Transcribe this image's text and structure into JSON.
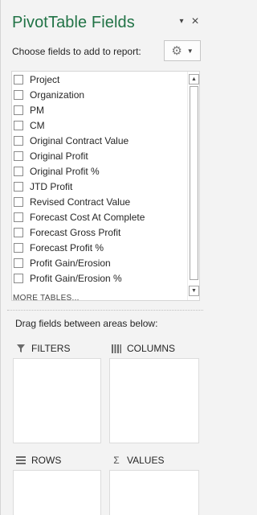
{
  "header": {
    "title": "PivotTable Fields",
    "dropdown_glyph": "▾",
    "close_glyph": "×"
  },
  "chooser": {
    "label": "Choose fields to add to report:",
    "settings_icon": "gear-icon",
    "settings_glyph": "⚙",
    "settings_caret": "▼"
  },
  "fields": [
    {
      "label": "Project",
      "checked": false
    },
    {
      "label": "Organization",
      "checked": false
    },
    {
      "label": "PM",
      "checked": false
    },
    {
      "label": "CM",
      "checked": false
    },
    {
      "label": "Original Contract Value",
      "checked": false
    },
    {
      "label": "Original Profit",
      "checked": false
    },
    {
      "label": "Original Profit %",
      "checked": false
    },
    {
      "label": "JTD Profit",
      "checked": false
    },
    {
      "label": "Revised Contract Value",
      "checked": false
    },
    {
      "label": "Forecast Cost At Complete",
      "checked": false
    },
    {
      "label": "Forecast Gross Profit",
      "checked": false
    },
    {
      "label": "Forecast Profit %",
      "checked": false
    },
    {
      "label": "Profit Gain/Erosion",
      "checked": false
    },
    {
      "label": "Profit Gain/Erosion %",
      "checked": false
    }
  ],
  "more_tables": "MORE TABLES...",
  "scrollbar": {
    "up_glyph": "▲",
    "down_glyph": "▼"
  },
  "drag_hint": "Drag fields between areas below:",
  "areas": {
    "filters": {
      "label": "FILTERS",
      "icon": "filter-icon"
    },
    "columns": {
      "label": "COLUMNS",
      "icon": "columns-icon"
    },
    "rows": {
      "label": "ROWS",
      "icon": "rows-icon"
    },
    "values": {
      "label": "VALUES",
      "icon": "sigma-icon",
      "glyph": "Σ"
    }
  },
  "colors": {
    "title": "#217346",
    "pane_background": "#f3f3f3"
  }
}
